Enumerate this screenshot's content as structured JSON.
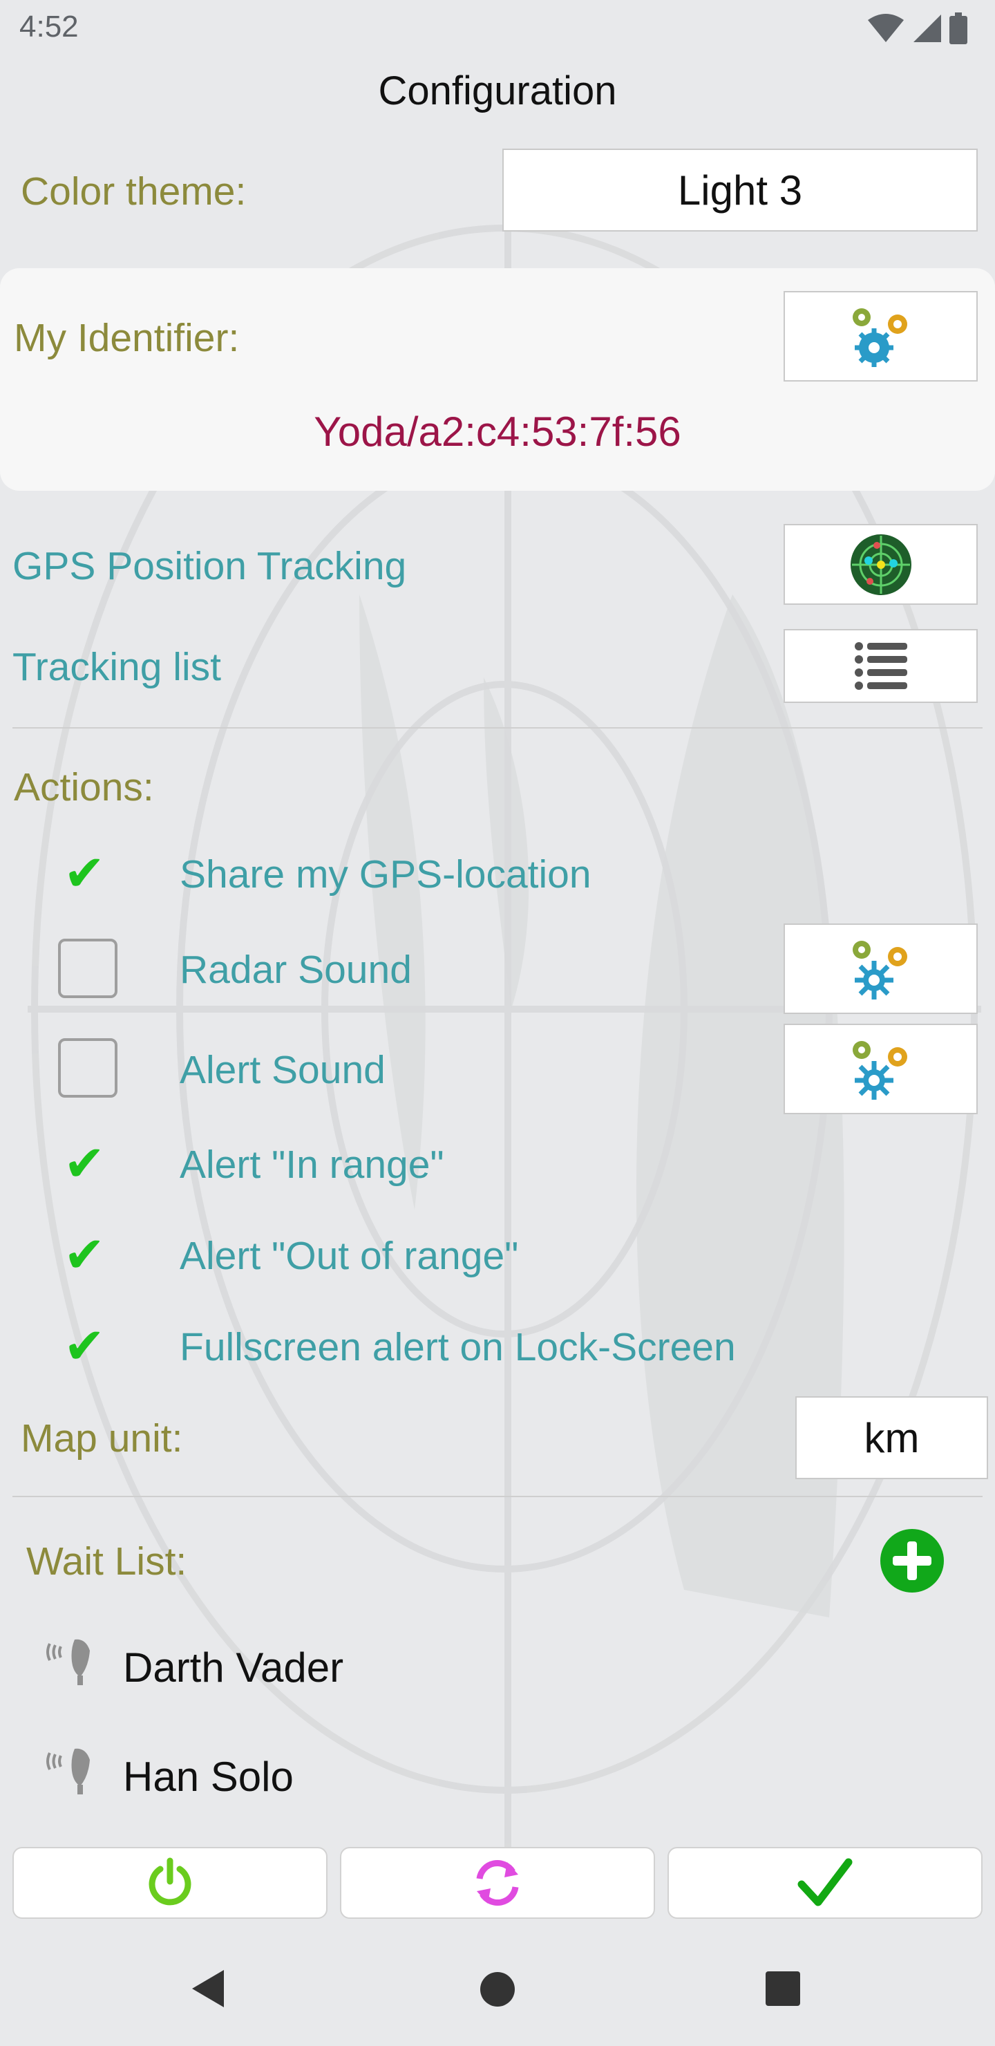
{
  "status": {
    "time": "4:52"
  },
  "header": {
    "title": "Configuration"
  },
  "color_theme": {
    "label": "Color theme:",
    "value": "Light 3"
  },
  "identity": {
    "label": "My Identifier:",
    "value": "Yoda/a2:c4:53:7f:56",
    "settings_icon": "gears-icon"
  },
  "gps_tracking": {
    "label": "GPS Position Tracking",
    "icon": "radar-icon"
  },
  "tracking_list": {
    "label": "Tracking list",
    "icon": "list-icon"
  },
  "actions": {
    "label": "Actions:",
    "items": [
      {
        "label": "Share my GPS-location",
        "checked": true
      },
      {
        "label": "Radar Sound",
        "checked": false
      },
      {
        "label": "Alert Sound",
        "checked": false
      },
      {
        "label": "Alert \"In range\"",
        "checked": true
      },
      {
        "label": "Alert \"Out of range\"",
        "checked": true
      },
      {
        "label": "Fullscreen alert on Lock-Screen",
        "checked": true
      }
    ]
  },
  "map_unit": {
    "label": "Map unit:",
    "value": "km"
  },
  "wait_list": {
    "label": "Wait List:",
    "add_icon": "plus-circle-icon",
    "items": [
      {
        "name": "Darth Vader"
      },
      {
        "name": "Han Solo"
      }
    ]
  },
  "bottom_bar": {
    "icons": [
      "power-icon",
      "sync-icon",
      "check-icon"
    ]
  },
  "colors": {
    "olive_label": "#8c8a3c",
    "teal_label": "#3f9fa6",
    "identifier": "#9c1548",
    "check_green": "#1ec41e",
    "add_green": "#11a81a",
    "sync_magenta": "#e04be0"
  }
}
